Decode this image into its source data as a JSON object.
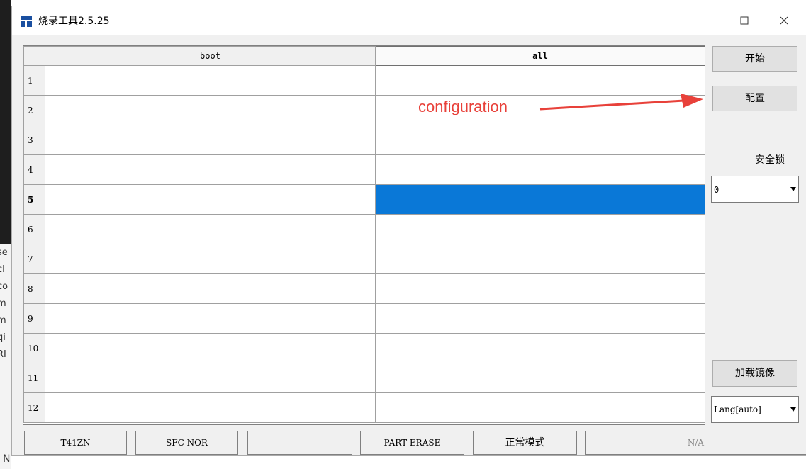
{
  "window": {
    "title": "烧录工具2.5.25",
    "controls": {
      "minimize": "—",
      "maximize": "☐",
      "close": "✕"
    }
  },
  "grid": {
    "columns": [
      "boot",
      "all"
    ],
    "rows": [
      "1",
      "2",
      "3",
      "4",
      "5",
      "6",
      "7",
      "8",
      "9",
      "10",
      "11",
      "12"
    ],
    "selected_row": "5"
  },
  "sidebar": {
    "start_label": "开始",
    "config_label": "配置",
    "lock_label": "安全锁",
    "lock_value": "0",
    "load_image_label": "加载镜像",
    "lang_value": "Lang[auto]"
  },
  "statusbar": {
    "chip": "T41ZN",
    "flash": "SFC NOR",
    "empty": "",
    "erase": "PART ERASE",
    "mode": "正常模式",
    "na": "N/A"
  },
  "annotation": {
    "text": "configuration",
    "color": "#e8413a"
  },
  "background": {
    "side_chars": [
      "se",
      "cl",
      "co",
      "m",
      "m",
      "qi",
      "RI"
    ],
    "bottom_char": "N"
  },
  "colors": {
    "highlight": "#0a78d7",
    "window_bg": "#f0f0f0"
  }
}
